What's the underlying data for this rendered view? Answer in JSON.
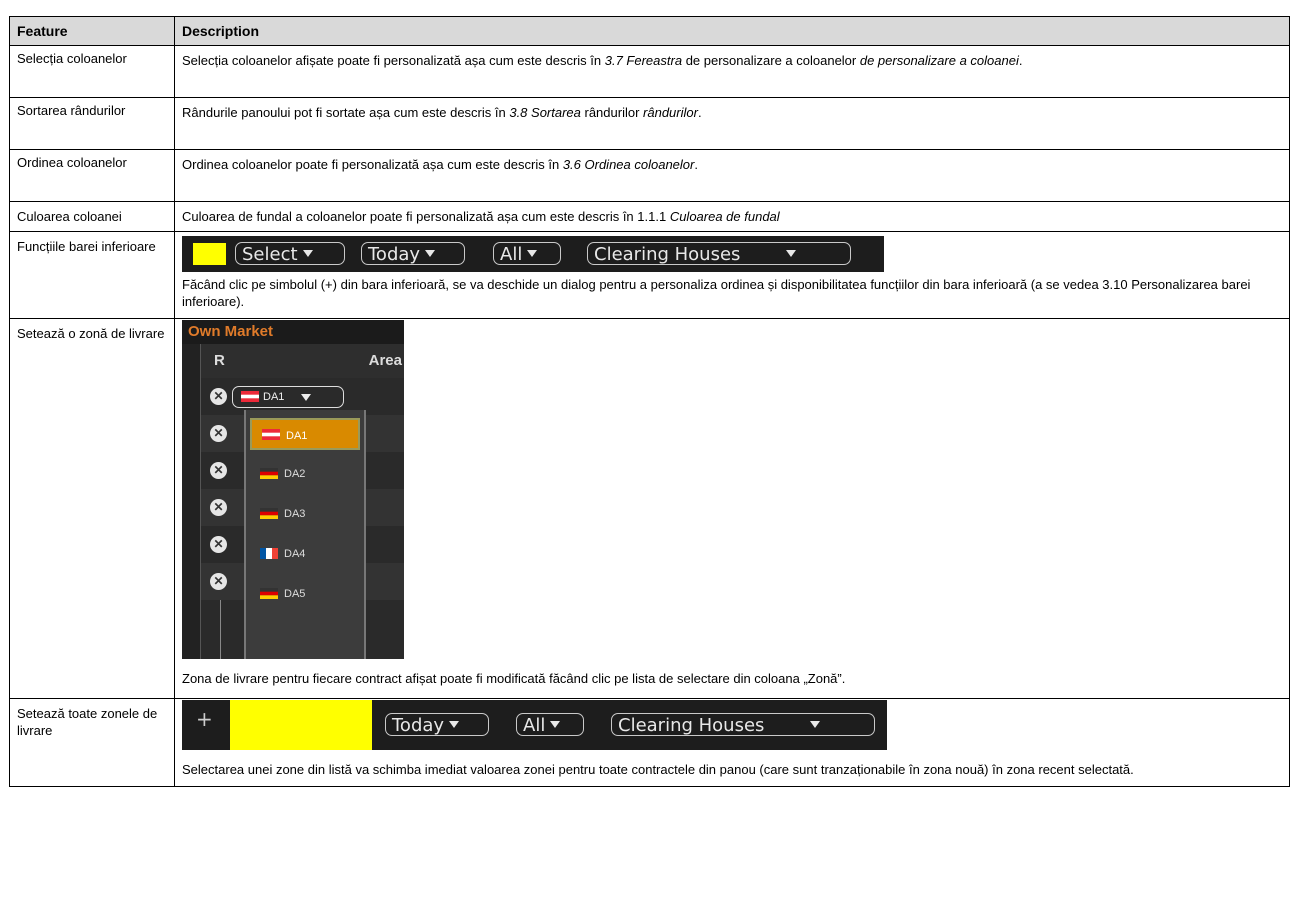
{
  "table": {
    "headers": [
      "Feature",
      "Description"
    ],
    "rows": [
      {
        "feature": "Selecția coloanelor",
        "desc_pre": "Selecția coloanelor afișate poate fi personalizată așa cum este descris în ",
        "desc_italic1": "3.7 Fereastra",
        "desc_mid": " de personalizare a coloanelor ",
        "desc_italic2": "de personalizare a coloanei",
        "desc_post": "."
      },
      {
        "feature": "Sortarea rândurilor",
        "desc_pre": "Rândurile panoului pot fi sortate așa cum este descris în ",
        "desc_italic1": "3.8 Sortarea",
        "desc_mid": " rândurilor ",
        "desc_italic2": "rândurilor",
        "desc_post": "."
      },
      {
        "feature": "Ordinea coloanelor",
        "desc_pre": "Ordinea coloanelor poate fi personalizată așa cum este descris în ",
        "desc_italic1": "3.6 Ordinea coloanelor",
        "desc_post": "."
      },
      {
        "feature": "Culoarea coloanei",
        "desc_pre": "Culoarea de fundal a coloanelor poate fi personalizată așa cum este descris în 1.1.1 ",
        "desc_italic1": "Culoarea de fundal"
      },
      {
        "feature": "Funcțiile barei inferioare",
        "toolbar": {
          "select_label": "Select",
          "today_label": "Today",
          "all_label": "All",
          "clearing_label": "Clearing Houses"
        },
        "desc": "Făcând clic pe simbolul (+) din bara inferioară, se va deschide un dialog pentru a personaliza ordinea și disponibilitatea funcțiilor din bara inferioară (a se vedea 3.10 Personalizarea barei inferioare)."
      },
      {
        "feature": "Setează o zonă de livrare",
        "widget": {
          "title": "Own Market",
          "col_r": "R",
          "col_area": "Area",
          "selected": "DA1",
          "options": [
            "DA1",
            "DA2",
            "DA3",
            "DA4",
            "DA5"
          ]
        },
        "desc": "Zona de livrare pentru fiecare contract afișat poate fi modificată făcând clic pe lista de selectare din coloana „Zonă”."
      },
      {
        "feature": "Setează toate zonele de livrare",
        "toolbar": {
          "plus": "+",
          "today_label": "Today",
          "all_label": "All",
          "clearing_label": "Clearing Houses"
        },
        "desc": "Selectarea unei zone din listă va schimba imediat valoarea zonei pentru toate contractele din panou (care sunt tranzaționabile în zona nouă) în zona recent selectată."
      }
    ]
  },
  "colors": {
    "header_bg": "#d9d9d9",
    "toolbar_bg": "#1d1d1d",
    "highlight": "#ffff00",
    "selected_option": "#d98a00",
    "title_orange": "#e07b2a"
  }
}
